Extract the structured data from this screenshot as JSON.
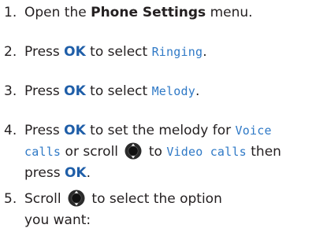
{
  "steps": [
    {
      "number": "1.",
      "parts": {
        "a": "Open the ",
        "b": "Phone Settings",
        "c": " menu."
      }
    },
    {
      "number": "2.",
      "parts": {
        "a": "Press ",
        "b": "OK",
        "c": " to select ",
        "d": "Ringing",
        "e": "."
      }
    },
    {
      "number": "3.",
      "parts": {
        "a": "Press ",
        "b": "OK",
        "c": " to select ",
        "d": "Melody",
        "e": "."
      }
    },
    {
      "number": "4.",
      "parts": {
        "a": "Press ",
        "b": "OK",
        "c": " to set the melody for ",
        "d": "Voice",
        "e": "calls",
        "f": " or scroll ",
        "g": " to ",
        "h": "Video calls",
        "i": " then",
        "j": "press ",
        "k": "OK",
        "l": "."
      }
    },
    {
      "number": "5.",
      "parts": {
        "a": "Scroll ",
        "b": " to select the option",
        "c": "you want:"
      }
    }
  ],
  "colors": {
    "text": "#231f20",
    "key": "#1f5ea8",
    "screen_text": "#2f79c6",
    "nav_key_dark": "#111111"
  },
  "icons": {
    "nav_key": "navigation-key-icon"
  }
}
